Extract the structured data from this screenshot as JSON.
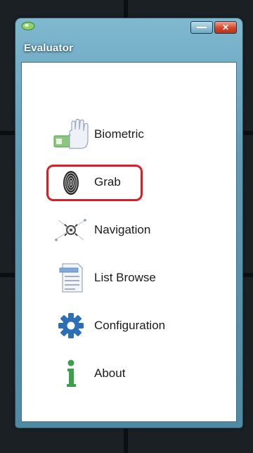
{
  "window": {
    "title": "Evaluator",
    "close_glyph": "✕"
  },
  "menu": {
    "items": [
      {
        "label": "Biometric",
        "icon": "hand-biometric-icon"
      },
      {
        "label": "Grab",
        "icon": "fingerprint-icon",
        "highlighted": true
      },
      {
        "label": "Navigation",
        "icon": "navigation-crosshair-icon"
      },
      {
        "label": "List Browse",
        "icon": "list-document-icon"
      },
      {
        "label": "Configuration",
        "icon": "gear-icon"
      },
      {
        "label": "About",
        "icon": "info-icon"
      }
    ]
  },
  "colors": {
    "highlight": "#d61f26",
    "titlebar": "#5f9bb5",
    "gear": "#2d6fb7",
    "info": "#3aa14a"
  }
}
